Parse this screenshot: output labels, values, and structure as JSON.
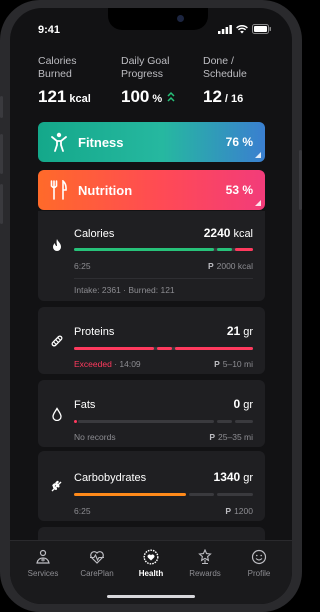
{
  "status": {
    "time": "9:41"
  },
  "stats": [
    {
      "label": "Calories\nBurned",
      "value": "121",
      "unit": "kcal"
    },
    {
      "label": "Daily Goal\nProgress",
      "value": "100",
      "unit": "%"
    },
    {
      "label": "Done /\nSchedule",
      "value": "12",
      "unit": "/ 16"
    }
  ],
  "banners": {
    "fitness": {
      "label": "Fitness",
      "percent": "76 %"
    },
    "nutrition": {
      "label": "Nutrition",
      "percent": "53 %"
    }
  },
  "cards": {
    "calories": {
      "title": "Calories",
      "value": "2240",
      "unit": "kcal",
      "meta": "6:25",
      "target": "2000 kcal",
      "target_glyph": "P",
      "extra": "Intake: 2361 · Burned: 121",
      "progress": 1.0
    },
    "proteins": {
      "title": "Proteins",
      "value": "21",
      "unit": "gr",
      "status": "Exceeded",
      "meta": "· 14:09",
      "target": "5–10 mi",
      "target_glyph": "P",
      "progress": 1.0
    },
    "fats": {
      "title": "Fats",
      "value": "0",
      "unit": "gr",
      "meta": "No records",
      "target": "25–35 mi",
      "target_glyph": "P",
      "progress": 0.0
    },
    "carbohydrates": {
      "title": "Carbobydrates",
      "value": "1340",
      "unit": "gr",
      "meta": "6:25",
      "target": "1200",
      "target_glyph": "P",
      "progress": 0.7
    }
  },
  "colors": {
    "accent_green": "#27c27a",
    "accent_red": "#ff3a5e",
    "accent_orange": "#ff8a1a"
  },
  "tabs": [
    {
      "label": "Services",
      "icon": "services-icon"
    },
    {
      "label": "CarePlan",
      "icon": "heartbeat-icon"
    },
    {
      "label": "Health",
      "icon": "health-heart-icon",
      "active": true
    },
    {
      "label": "Rewards",
      "icon": "trophy-icon"
    },
    {
      "label": "Profile",
      "icon": "smiley-icon"
    }
  ]
}
